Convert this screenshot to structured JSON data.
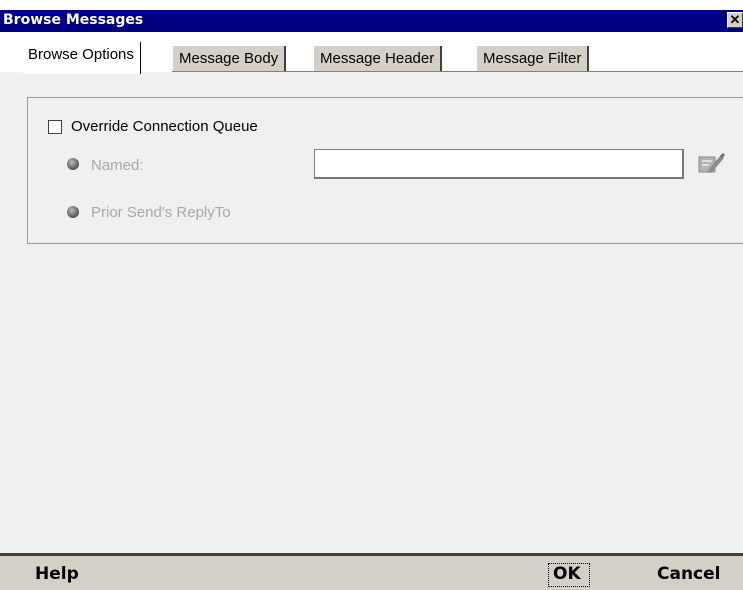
{
  "window": {
    "title": "Browse Messages",
    "close_glyph": "✕"
  },
  "tabs": [
    {
      "label": "Browse Options",
      "active": true
    },
    {
      "label": "Message Body",
      "active": false
    },
    {
      "label": "Message Header",
      "active": false
    },
    {
      "label": "Message Filter",
      "active": false
    }
  ],
  "options": {
    "override_label": "Override Connection Queue",
    "override_checked": false,
    "named_label": "Named:",
    "named_value": "",
    "prior_label": "Prior Send's ReplyTo",
    "edit_icon": "edit-icon"
  },
  "footer": {
    "help_label": "Help",
    "ok_label": "OK",
    "cancel_label": "Cancel"
  },
  "colors": {
    "title_bar": "#000080",
    "panel": "#f0f0f0",
    "button_bar": "#d4d0c8",
    "disabled_text": "#a8a8a8"
  }
}
